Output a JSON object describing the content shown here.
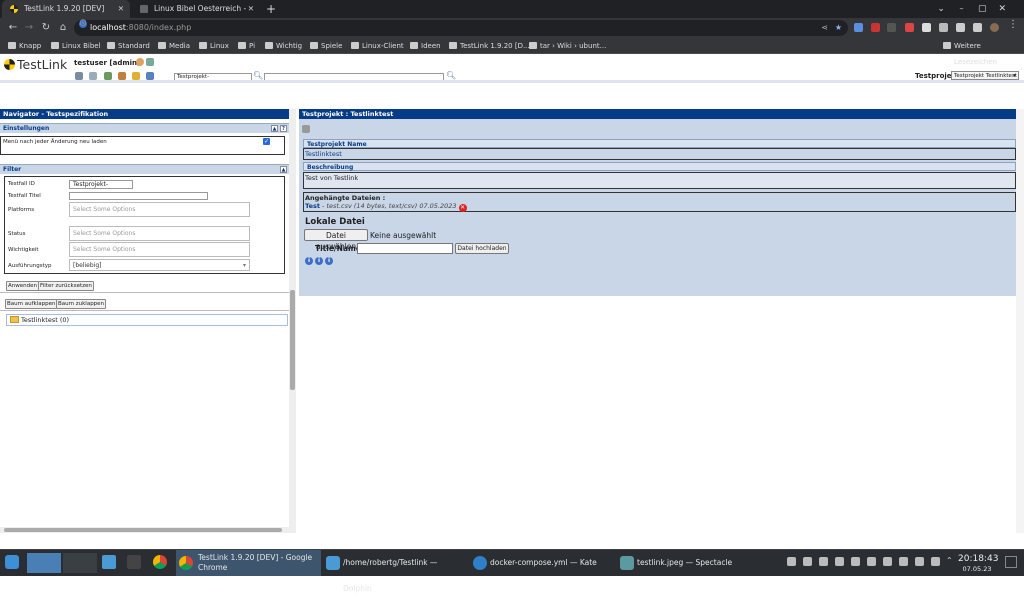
{
  "browser": {
    "tabs": [
      {
        "title": "TestLink 1.9.20 [DEV]",
        "active": true
      },
      {
        "title": "Linux Bibel Oesterreich - Neu",
        "active": false
      }
    ],
    "url_host": "localhost",
    "url_rest": ":8080/index.php",
    "bookmarks": [
      "Knapp",
      "Linux Bibel",
      "Standard",
      "Media",
      "Linux",
      "Pi",
      "Wichtig",
      "Spiele",
      "Linux-Client",
      "Ideen",
      "TestLink 1.9.20 [D...",
      "tar › Wiki › ubunt..."
    ],
    "bookmarks_other": "Weitere Lesezeichen"
  },
  "header": {
    "logo": "TestLink",
    "user": "testuser [admin]",
    "tp_search_value": "Testprojekt-",
    "testprojekt_label": "Testprojekt",
    "testprojekt_selected": "Testprojekt Testlinktest"
  },
  "navigator": {
    "title": "Navigator - Testspezifikation",
    "settings_title": "Einstellungen",
    "settings_option": "Menü nach jeder Änderung neu laden",
    "filter_title": "Filter",
    "fields": {
      "testfall_id_label": "Testfall ID",
      "testfall_id_value": "Testprojekt-",
      "testfall_titel_label": "Testfall Titel",
      "platforms_label": "Platforms",
      "platforms_placeholder": "Select Some Options",
      "status_label": "Status",
      "status_placeholder": "Select Some Options",
      "wichtigkeit_label": "Wichtigkeit",
      "wichtigkeit_placeholder": "Select Some Options",
      "ausfuehrungstyp_label": "Ausführungstyp",
      "ausfuehrungstyp_value": "[beliebig]"
    },
    "apply_button": "Anwenden",
    "reset_button": "Filter zurücksetzen",
    "expand_button": "Baum aufklappen",
    "collapse_button": "Baum zuklappen",
    "tree_root": "Testlinktest (0)"
  },
  "main": {
    "title": "Testprojekt : Testlinktest",
    "name_label": "Testprojekt Name",
    "name_value": "Testlinktest",
    "desc_label": "Beschreibung",
    "desc_value": "Test von Testlink",
    "attached_label": "Angehängte Dateien :",
    "attachment_name": "Test",
    "attachment_meta": "- test.csv (14 bytes, text/csv) 07.05.2023",
    "local_file_label": "Lokale Datei",
    "choose_file_button": "Datei auswählen",
    "no_file_text": "Keine ausgewählt",
    "title_name_label": "Title/Name:",
    "upload_button": "Datei hochladen"
  },
  "taskbar": {
    "items": [
      "TestLink 1.9.20 [DEV] - Google Chrome",
      "/home/robertg/Testlink — Dolphin",
      "docker-compose.yml — Kate",
      "testlink.jpeg — Spectacle"
    ],
    "time": "20:18:43",
    "date": "07.05.23"
  }
}
